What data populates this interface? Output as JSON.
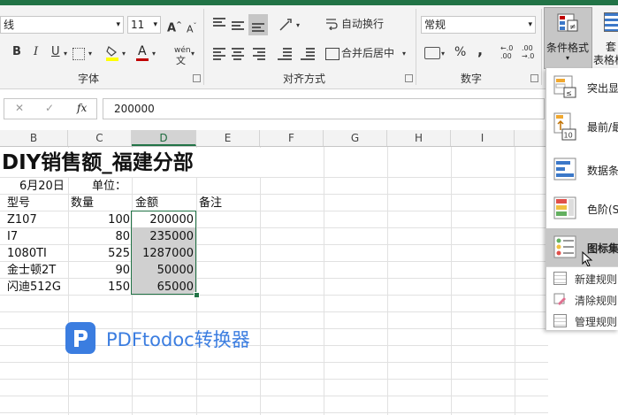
{
  "ribbon": {
    "font_name": "线",
    "font_size": "11",
    "grow_font": "A",
    "shrink_font": "A",
    "bold": "B",
    "italic": "I",
    "underline": "U",
    "phonetic": "wén",
    "font_color_glyph": "A",
    "wrap_text": "自动换行",
    "merge_center": "合并后居中",
    "number_format": "常规",
    "percent": "%",
    "comma": ",",
    "cond_format_line1": "条件格式",
    "table_line1": "套",
    "table_line2": "表格格",
    "group_font": "字体",
    "group_align": "对齐方式",
    "group_number": "数字"
  },
  "formula_bar": {
    "cancel": "✕",
    "enter": "✓",
    "fx": "fx",
    "value": "200000"
  },
  "columns": [
    "B",
    "C",
    "D",
    "E",
    "F",
    "G",
    "H",
    "I"
  ],
  "sheet": {
    "title": "DIY销售额_福建分部",
    "date": "6月20日",
    "unit": "单位：",
    "headers": {
      "model": "型号",
      "qty": "数量",
      "amount": "金额",
      "note": "备注"
    },
    "rows": [
      {
        "model": "Z107",
        "qty": "100",
        "amount": "200000"
      },
      {
        "model": "I7",
        "qty": "80",
        "amount": "235000"
      },
      {
        "model": "1080TI",
        "qty": "525",
        "amount": "1287000"
      },
      {
        "model": "金士顿2T",
        "qty": "90",
        "amount": "50000"
      },
      {
        "model": "闪迪512G",
        "qty": "150",
        "amount": "65000"
      }
    ]
  },
  "watermark": {
    "text": "PDFtodoc转换器",
    "color": "#3b7de0"
  },
  "menu": {
    "items": [
      {
        "label": "突出显"
      },
      {
        "label": "最前/最"
      },
      {
        "label": "数据条"
      },
      {
        "label": "色阶(S"
      },
      {
        "label": "图标集"
      }
    ],
    "small_items": [
      {
        "label": "新建规则"
      },
      {
        "label": "清除规则"
      },
      {
        "label": "管理规则"
      }
    ],
    "icon_badge": "10"
  },
  "colors": {
    "accent": "#217346",
    "selection": "#d0d0d0"
  }
}
